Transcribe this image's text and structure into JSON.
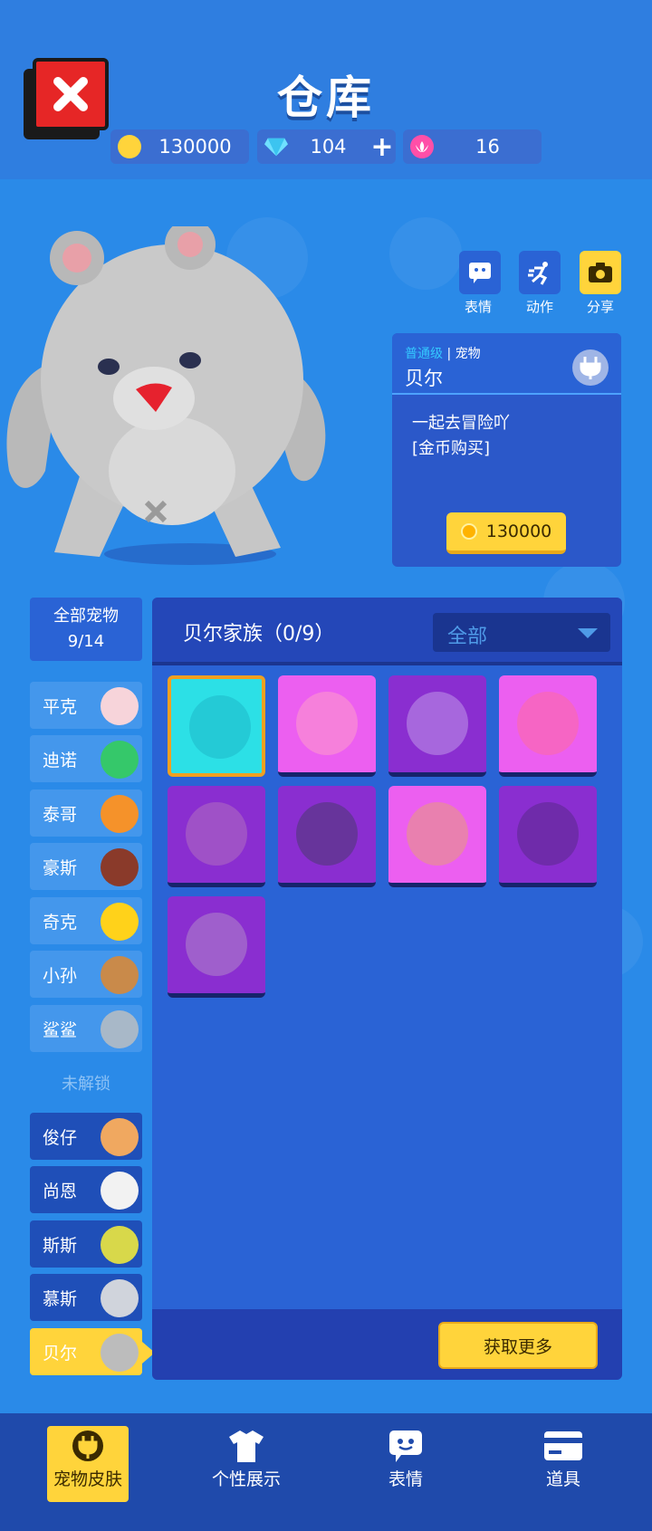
{
  "header": {
    "title": "仓库",
    "coins": "130000",
    "diamonds": "104",
    "tickets": "16"
  },
  "actions": [
    {
      "label": "表情",
      "icon": "emoji-icon"
    },
    {
      "label": "动作",
      "icon": "motion-icon"
    },
    {
      "label": "分享",
      "icon": "camera-icon"
    }
  ],
  "pet_card": {
    "level": "普通级",
    "type": "宠物",
    "name": "贝尔",
    "desc_line1": "一起去冒险吖",
    "desc_line2": "[金币购买]",
    "price": "130000"
  },
  "sidebar": {
    "all_label": "全部宠物",
    "all_count": "9/14",
    "unlocked": [
      "平克",
      "迪诺",
      "泰哥",
      "豪斯",
      "奇克",
      "小孙",
      "鲨鲨"
    ],
    "locked_label": "未解锁",
    "locked": [
      "俊仔",
      "尚恩",
      "斯斯",
      "慕斯"
    ],
    "selected": "贝尔"
  },
  "panel": {
    "title": "贝尔家族（0/9）",
    "filter": "全部",
    "more_button": "获取更多"
  },
  "tabs": [
    "宠物皮肤",
    "个性展示",
    "表情",
    "道具"
  ],
  "colors": {
    "accent_yellow": "#ffd43b",
    "close_red": "#e62626",
    "panel_blue": "#2a63d5"
  }
}
